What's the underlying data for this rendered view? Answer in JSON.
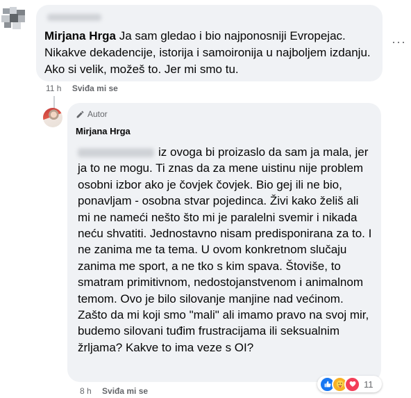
{
  "comment1": {
    "author": "Mirjana Hrga",
    "text": "Ja sam gledao i bio najponosniji Evropejac. Nikakve dekadencije, istorija i samoironija u najboljem izdanju. Ako si velik, možeš to. Jer mi smo tu.",
    "time": "11 h",
    "like_label": "Sviđa mi se",
    "more_label": "···"
  },
  "comment2": {
    "badge": "Autor",
    "author": "Mirjana Hrga",
    "text": "iz ovoga bi proizaslo da sam ja mala, jer ja to ne mogu. Ti znas da za mene uistinu nije problem osobni izbor ako je čovjek čovjek. Bio gej ili ne bio, ponavljam - osobna stvar pojedinca. Živi kako želiš ali mi ne namećі nešto što mi je paralelni svemir i nikada neću shvatiti. Jednostavno nisam predisponirana za to. I ne zanima me ta tema. U ovom konkretnom slučaju zanima me sport, a ne tko s kim spava. Štoviše, to smatram primitivnom, nedostojanstvenom i animalnom temom. Ovo je bilo silovanje manjine nad većinom. Zašto da mi koji smo \"mali\" ali imamo pravo na svoj mir, budemo silovani tuđim frustracijama ili seksualnim žrljama? Kakve to ima veze s OI?",
    "time": "8 h",
    "like_label": "Sviđa mi se",
    "reaction_count": "11",
    "reactions": [
      "like-icon",
      "care-icon",
      "love-icon"
    ]
  },
  "colors": {
    "bubble": "#f0f2f5",
    "meta": "#65676b",
    "like": "#1877f2",
    "love": "#f33e58",
    "care": "#f7b125"
  }
}
